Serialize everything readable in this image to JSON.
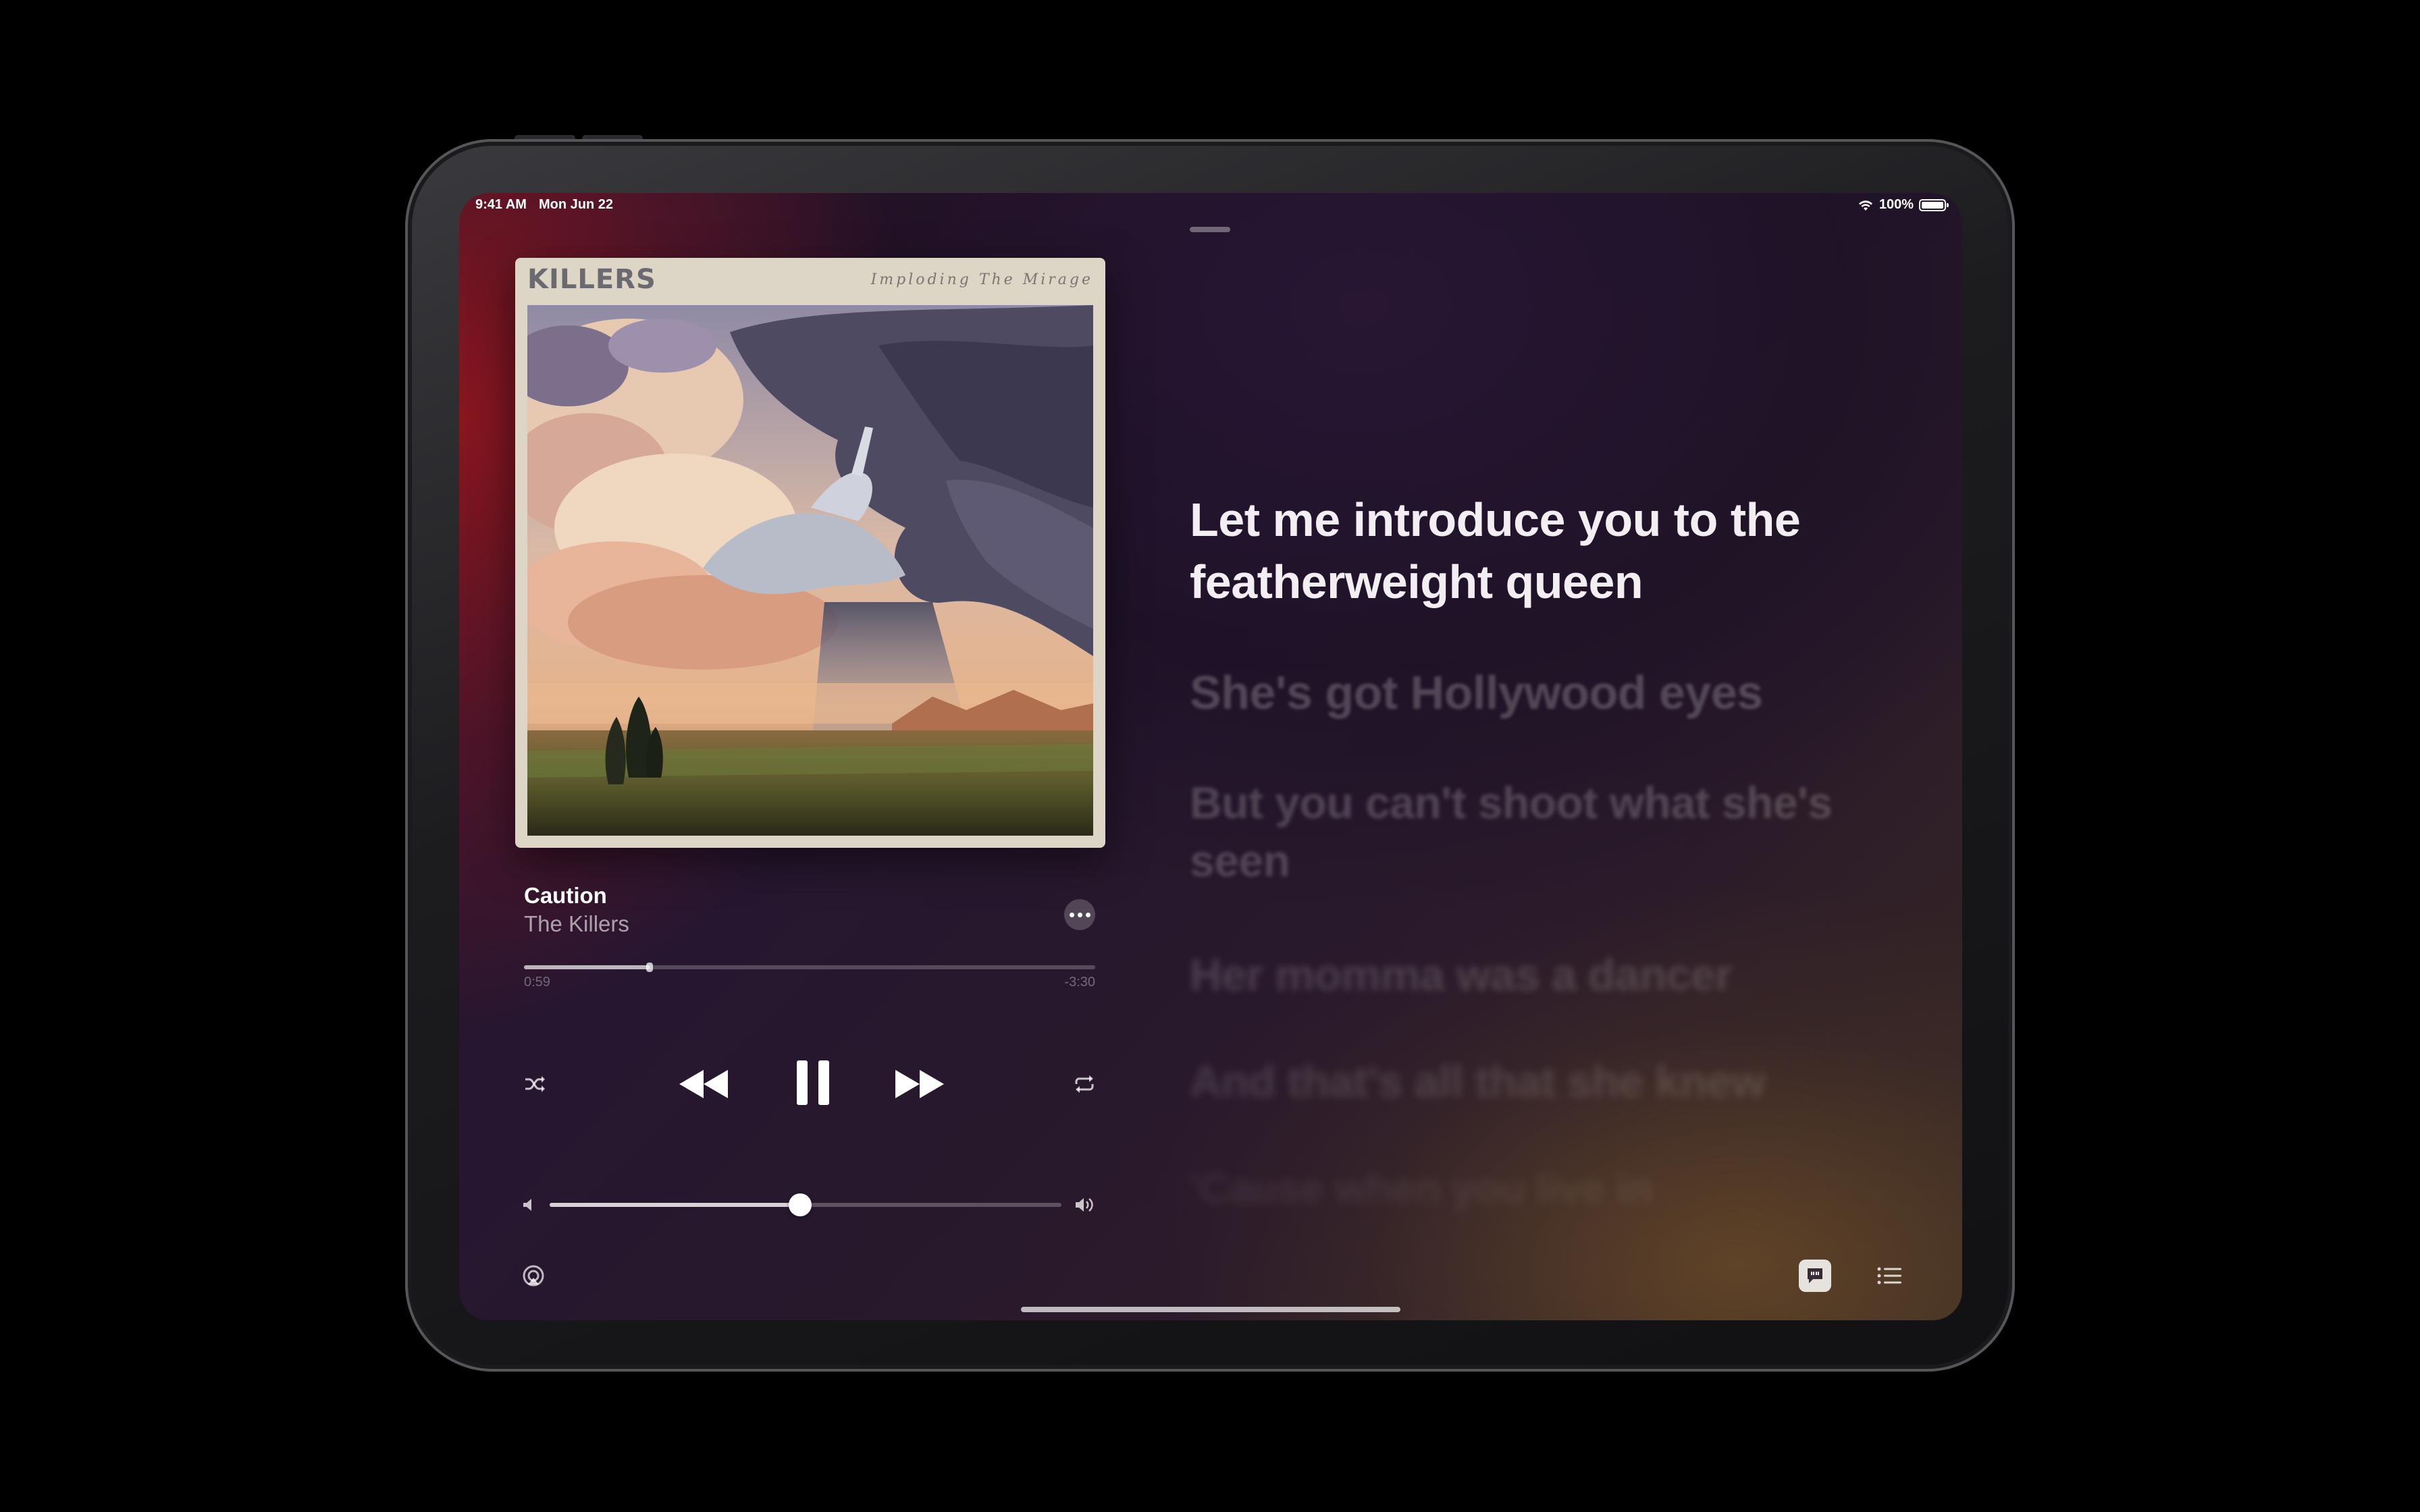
{
  "status_bar": {
    "time": "9:41 AM",
    "date": "Mon Jun 22",
    "battery": "100%"
  },
  "album": {
    "artist_logo": "KILLERS",
    "title_text": "Imploding The Mirage"
  },
  "track": {
    "title": "Caution",
    "artist": "The Killers"
  },
  "playback": {
    "elapsed": "0:59",
    "remaining": "-3:30",
    "progress": 0.22,
    "volume": 0.49,
    "state": "playing"
  },
  "lyrics": {
    "current": "Let me introduce you to the featherweight queen",
    "upcoming": [
      "She's got Hollywood eyes",
      "But you can't shoot what she's seen",
      "Her momma was a dancer",
      "And that's all that she knew",
      "'Cause when you live in"
    ]
  },
  "icons": {
    "shuffle": "shuffle-icon",
    "rewind": "rewind-icon",
    "pause": "pause-icon",
    "forward": "fast-forward-icon",
    "repeat": "repeat-icon",
    "airplay": "airplay-icon",
    "lyrics": "lyrics-icon",
    "queue": "queue-list-icon",
    "more": "ellipsis-icon"
  },
  "colors": {
    "accent_red": "#8c161e",
    "text_primary": "#ffffff"
  }
}
